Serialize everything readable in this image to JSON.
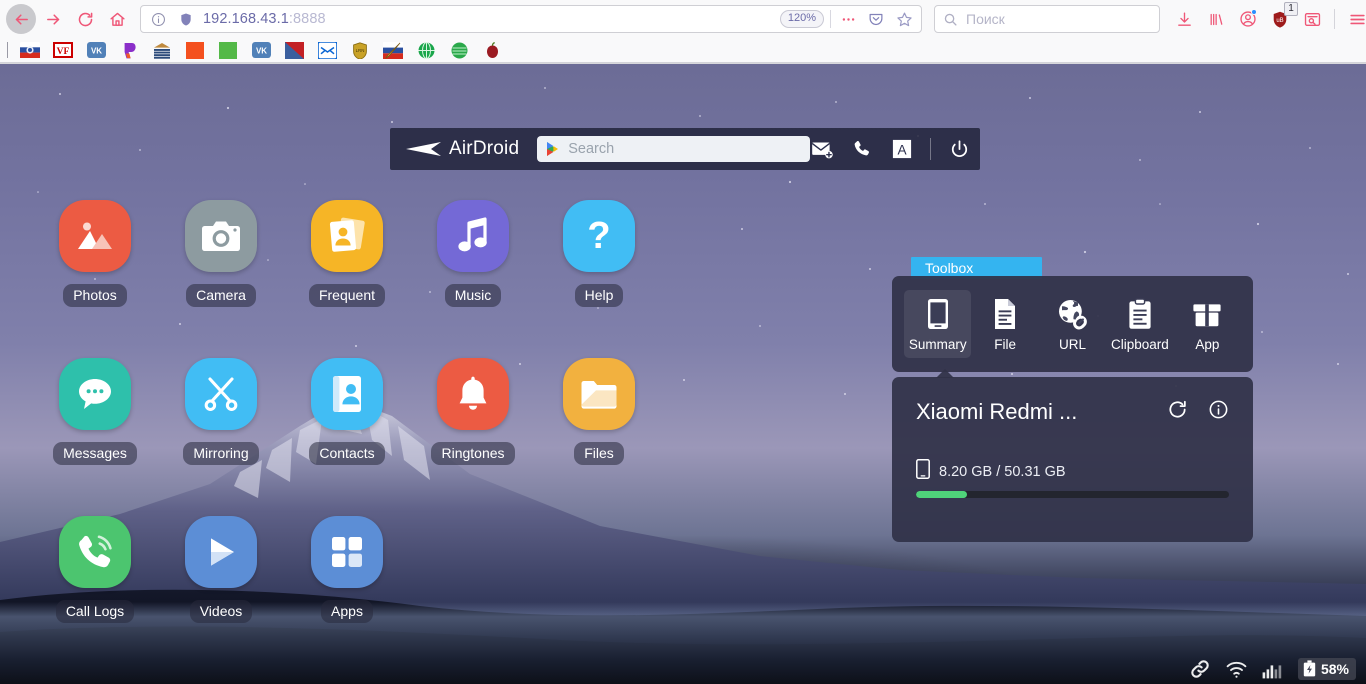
{
  "browser": {
    "nav": {
      "back_label": "Back",
      "forward_label": "Forward",
      "reload_label": "Reload",
      "home_label": "Home"
    },
    "urlbar": {
      "host": "192.168.43.1",
      "port": ":8888",
      "zoom_level": "120%",
      "identity_label": "Site information",
      "tracking_label": "Tracking protection",
      "page_actions_label": "Page actions",
      "pocket_label": "Save to Pocket",
      "bookmark_label": "Bookmark this page"
    },
    "search": {
      "placeholder": "Поиск",
      "icon": "search-icon"
    },
    "toolbar_right": {
      "downloads_label": "Downloads",
      "library_label": "Library",
      "account_label": "Account",
      "ublock_label": "uBlock Origin",
      "ublock_badge": "1",
      "reader_label": "Reader view",
      "menu_label": "Open menu"
    },
    "bookmarks": [
      {
        "name": "bookmark-russia",
        "color": "#d8e2f0"
      },
      {
        "name": "bookmark-vf",
        "color": "#cc0000"
      },
      {
        "name": "bookmark-vk-1",
        "color": "#5181b8"
      },
      {
        "name": "bookmark-purple",
        "color": "#8b2fc9"
      },
      {
        "name": "bookmark-layers",
        "color": "#c08a3e"
      },
      {
        "name": "bookmark-orange",
        "color": "#f4501e"
      },
      {
        "name": "bookmark-green",
        "color": "#54b948"
      },
      {
        "name": "bookmark-vk-2",
        "color": "#5181b8"
      },
      {
        "name": "bookmark-flag-diag",
        "color": "#c32025"
      },
      {
        "name": "bookmark-mail",
        "color": "#0b66d3"
      },
      {
        "name": "bookmark-shield",
        "color": "#c9a227"
      },
      {
        "name": "bookmark-pen-flag",
        "color": "#2b5fb0"
      },
      {
        "name": "bookmark-globe-green",
        "color": "#1aa64b"
      },
      {
        "name": "bookmark-disc-green",
        "color": "#2aa84a"
      },
      {
        "name": "bookmark-apple",
        "color": "#9b1b22"
      }
    ]
  },
  "airdroid": {
    "brand": "AirDroid",
    "search_placeholder": "Search",
    "actions": [
      {
        "name": "new-message-icon",
        "label": "New message"
      },
      {
        "name": "call-icon",
        "label": "Call"
      },
      {
        "name": "app-letter-icon",
        "label": "A"
      },
      {
        "name": "power-icon",
        "label": "Power"
      }
    ]
  },
  "desktop": {
    "apps": [
      {
        "label": "Photos",
        "icon": "photos-icon",
        "color": "#ec5b43"
      },
      {
        "label": "Camera",
        "icon": "camera-icon",
        "color": "#8d9ba0"
      },
      {
        "label": "Frequent",
        "icon": "frequent-icon",
        "color": "#f6b526"
      },
      {
        "label": "Music",
        "icon": "music-icon",
        "color": "#7469d6"
      },
      {
        "label": "Help",
        "icon": "help-icon",
        "color": "#41bdf4"
      },
      {
        "label": "Messages",
        "icon": "messages-icon",
        "color": "#2ec0ab"
      },
      {
        "label": "Mirroring",
        "icon": "mirroring-icon",
        "color": "#41bdf4"
      },
      {
        "label": "Contacts",
        "icon": "contacts-icon",
        "color": "#41bdf4"
      },
      {
        "label": "Ringtones",
        "icon": "ringtones-icon",
        "color": "#ec5b43"
      },
      {
        "label": "Files",
        "icon": "files-icon",
        "color": "#f2b13f"
      },
      {
        "label": "Call Logs",
        "icon": "calllogs-icon",
        "color": "#4cc56f"
      },
      {
        "label": "Videos",
        "icon": "videos-icon",
        "color": "#5c8ed6"
      },
      {
        "label": "Apps",
        "icon": "apps-icon",
        "color": "#5c8ed6"
      }
    ]
  },
  "toolbox": {
    "tab_label": "Toolbox",
    "items": [
      {
        "label": "Summary",
        "icon": "phone-icon",
        "selected": true
      },
      {
        "label": "File",
        "icon": "file-icon",
        "selected": false
      },
      {
        "label": "URL",
        "icon": "globe-link-icon",
        "selected": false
      },
      {
        "label": "Clipboard",
        "icon": "clipboard-icon",
        "selected": false
      },
      {
        "label": "App",
        "icon": "package-icon",
        "selected": false
      }
    ]
  },
  "device": {
    "name": "Xiaomi Redmi ...",
    "refresh_label": "Refresh",
    "info_label": "Device info",
    "storage": {
      "icon": "phone-storage-icon",
      "text": "8.20 GB / 50.31 GB",
      "used_gb": 8.2,
      "total_gb": 50.31,
      "percent": 16.3
    }
  },
  "status_bar": {
    "link_label": "Connected",
    "wifi_label": "Wi-Fi",
    "signal_label": "Signal",
    "battery": "58%"
  },
  "colors": {
    "accent_blue": "#34b4f0",
    "panel": "rgba(48,50,72,0.93)",
    "storage_green": "#4fd37a",
    "firefox_pink": "#ef5777"
  }
}
